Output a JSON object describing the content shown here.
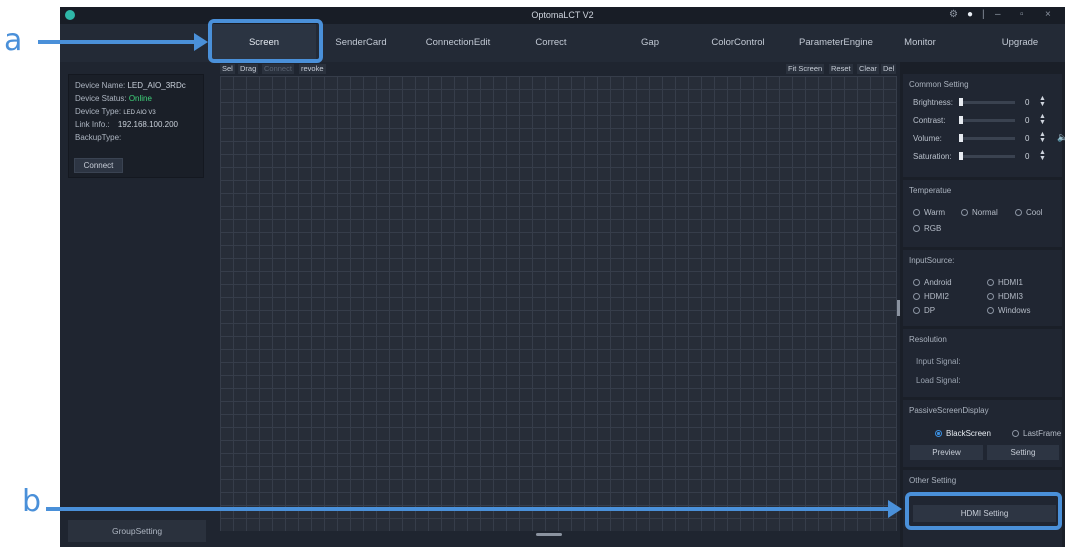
{
  "app": {
    "title": "OptomaLCT V2",
    "window_controls": {
      "minimize": "–",
      "maximize": "▫",
      "close": "×"
    }
  },
  "callouts": {
    "a": "a",
    "b": "b"
  },
  "nav": {
    "tabs": [
      {
        "label": "Screen",
        "active": true
      },
      {
        "label": "SenderCard"
      },
      {
        "label": "ConnectionEdit"
      },
      {
        "label": "Correct"
      },
      {
        "label": "Gap"
      },
      {
        "label": "ColorControl"
      },
      {
        "label": "ParameterEngine"
      },
      {
        "label": "Monitor"
      },
      {
        "label": "Upgrade"
      }
    ]
  },
  "device": {
    "name_label": "Device Name:",
    "name_value": "LED_AIO_3RDc",
    "status_label": "Device Status:",
    "status_value": "Online",
    "type_label": "Device Type:",
    "type_value": "LED AIO V3",
    "link_label": "Link Info.:",
    "link_value": "192.168.100.200",
    "backup_label": "BackupType:",
    "connect_label": "Connect"
  },
  "left": {
    "group_setting_label": "GroupSetting"
  },
  "toolbar": {
    "sel": "Sel",
    "drag": "Drag",
    "connect": "Connect",
    "revoke": "revoke",
    "fit_screen": "Fit Screen",
    "reset": "Reset",
    "clear": "Clear",
    "del": "Del"
  },
  "common_setting": {
    "title": "Common Setting",
    "sliders": [
      {
        "label": "Brightness:",
        "value": "0"
      },
      {
        "label": "Contrast:",
        "value": "0"
      },
      {
        "label": "Volume:",
        "value": "0"
      },
      {
        "label": "Saturation:",
        "value": "0"
      }
    ]
  },
  "temperature": {
    "title": "Temperatue",
    "options": [
      "Warm",
      "Normal",
      "Cool",
      "RGB"
    ]
  },
  "input_source": {
    "title": "InputSource:",
    "options": [
      "Android",
      "HDMI1",
      "HDMI2",
      "HDMI3",
      "DP",
      "Windows"
    ]
  },
  "resolution": {
    "title": "Resolution",
    "input_signal": "Input Signal:",
    "load_signal": "Load Signal:"
  },
  "passive_display": {
    "title": "PassiveScreenDisplay",
    "options": [
      {
        "label": "BlackScreen",
        "checked": true
      },
      {
        "label": "LastFrame",
        "checked": false
      }
    ],
    "preview_label": "Preview",
    "setting_label": "Setting"
  },
  "other_setting": {
    "title": "Other Setting",
    "hdmi_setting_label": "HDMI Setting"
  },
  "colors": {
    "accent": "#4a90d9",
    "online": "#3fd17a",
    "app_bg": "#1f2530"
  }
}
